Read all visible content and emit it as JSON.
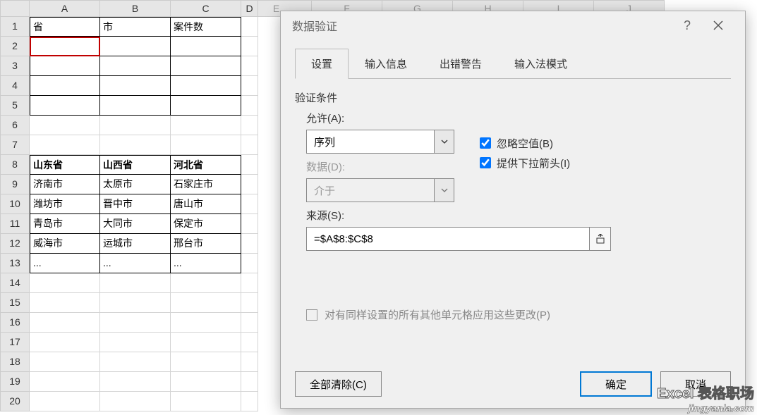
{
  "columns": [
    "A",
    "B",
    "C",
    "D"
  ],
  "bg_columns": [
    "E",
    "F",
    "G",
    "H",
    "I",
    "J"
  ],
  "row_labels": [
    "1",
    "2",
    "3",
    "4",
    "5",
    "6",
    "7",
    "8",
    "9",
    "10",
    "11",
    "12",
    "13",
    "14",
    "15",
    "16",
    "17",
    "18",
    "19",
    "20"
  ],
  "grid": {
    "r1": {
      "A": "省",
      "B": "市",
      "C": "案件数"
    },
    "r8": {
      "A": "山东省",
      "B": "山西省",
      "C": "河北省"
    },
    "r9": {
      "A": "济南市",
      "B": "太原市",
      "C": "石家庄市"
    },
    "r10": {
      "A": "潍坊市",
      "B": "晋中市",
      "C": "唐山市"
    },
    "r11": {
      "A": "青岛市",
      "B": "大同市",
      "C": "保定市"
    },
    "r12": {
      "A": "威海市",
      "B": "运城市",
      "C": "邢台市"
    },
    "r13": {
      "A": "...",
      "B": "...",
      "C": "..."
    }
  },
  "dialog": {
    "title": "数据验证",
    "tabs": [
      "设置",
      "输入信息",
      "出错警告",
      "输入法模式"
    ],
    "section_label": "验证条件",
    "allow_label": "允许(A):",
    "allow_value": "序列",
    "data_label": "数据(D):",
    "data_value": "介于",
    "chk_ignore": "忽略空值(B)",
    "chk_dropdown": "提供下拉箭头(I)",
    "source_label": "来源(S):",
    "source_value": "=$A$8:$C$8",
    "apply_label": "对有同样设置的所有其他单元格应用这些更改(P)",
    "clear_btn": "全部清除(C)",
    "ok_btn": "确定",
    "cancel_btn": "取消",
    "help": "?",
    "close": "×"
  },
  "watermark": {
    "line1": "Excel 表格职场",
    "line2": "jingyanla.com"
  }
}
